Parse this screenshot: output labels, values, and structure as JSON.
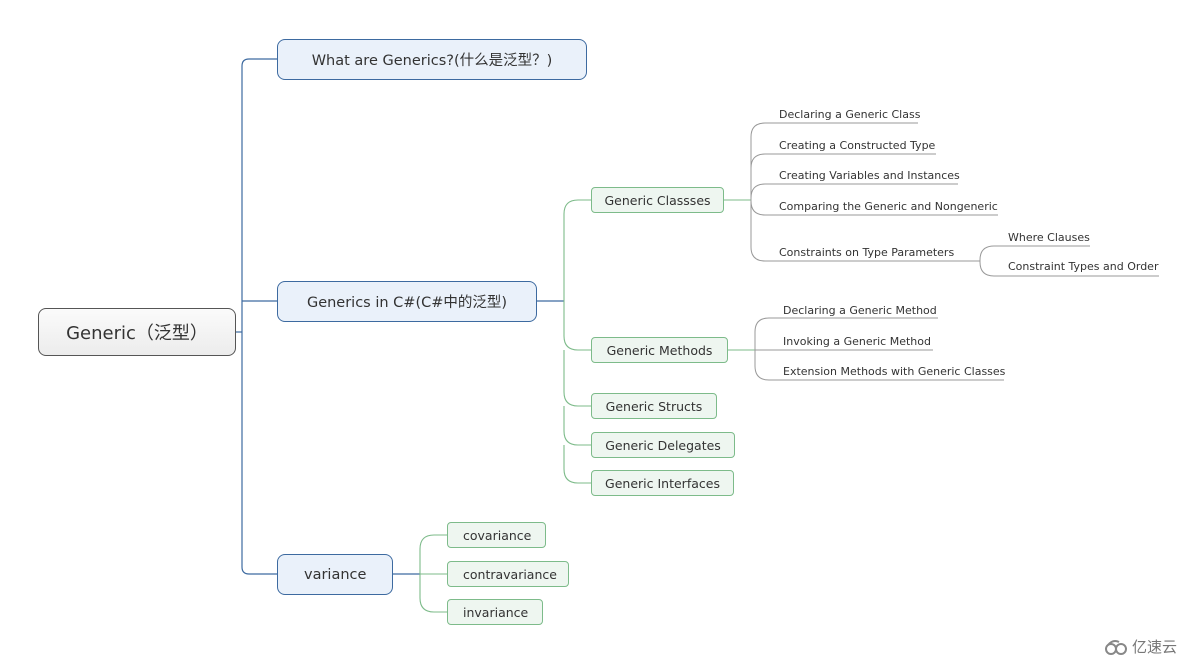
{
  "root": {
    "label": "Generic（泛型）"
  },
  "branches": [
    {
      "label": "What are Generics?(什么是泛型？)"
    },
    {
      "label": "Generics in C#(C#中的泛型)",
      "children": [
        {
          "label": "Generic Classses",
          "children": [
            {
              "label": "Declaring a Generic Class"
            },
            {
              "label": "Creating a Constructed Type"
            },
            {
              "label": "Creating Variables and Instances"
            },
            {
              "label": "Comparing the Generic and Nongeneric"
            },
            {
              "label": "Constraints on Type Parameters",
              "children": [
                {
                  "label": "Where Clauses"
                },
                {
                  "label": "Constraint Types and Order"
                }
              ]
            }
          ]
        },
        {
          "label": "Generic Methods",
          "children": [
            {
              "label": "Declaring a Generic Method"
            },
            {
              "label": "Invoking a Generic Method"
            },
            {
              "label": "Extension Methods with Generic Classes"
            }
          ]
        },
        {
          "label": "Generic Structs"
        },
        {
          "label": "Generic Delegates"
        },
        {
          "label": "Generic Interfaces"
        }
      ]
    },
    {
      "label": "variance",
      "children": [
        {
          "label": "covariance"
        },
        {
          "label": "contravariance"
        },
        {
          "label": "invariance"
        }
      ]
    }
  ],
  "watermark": {
    "icon": "cloud-logo-icon",
    "text": "亿速云"
  },
  "colors": {
    "blue_line": "#3d6aa0",
    "green_line": "#7dbb8a",
    "gray_line": "#999999"
  }
}
